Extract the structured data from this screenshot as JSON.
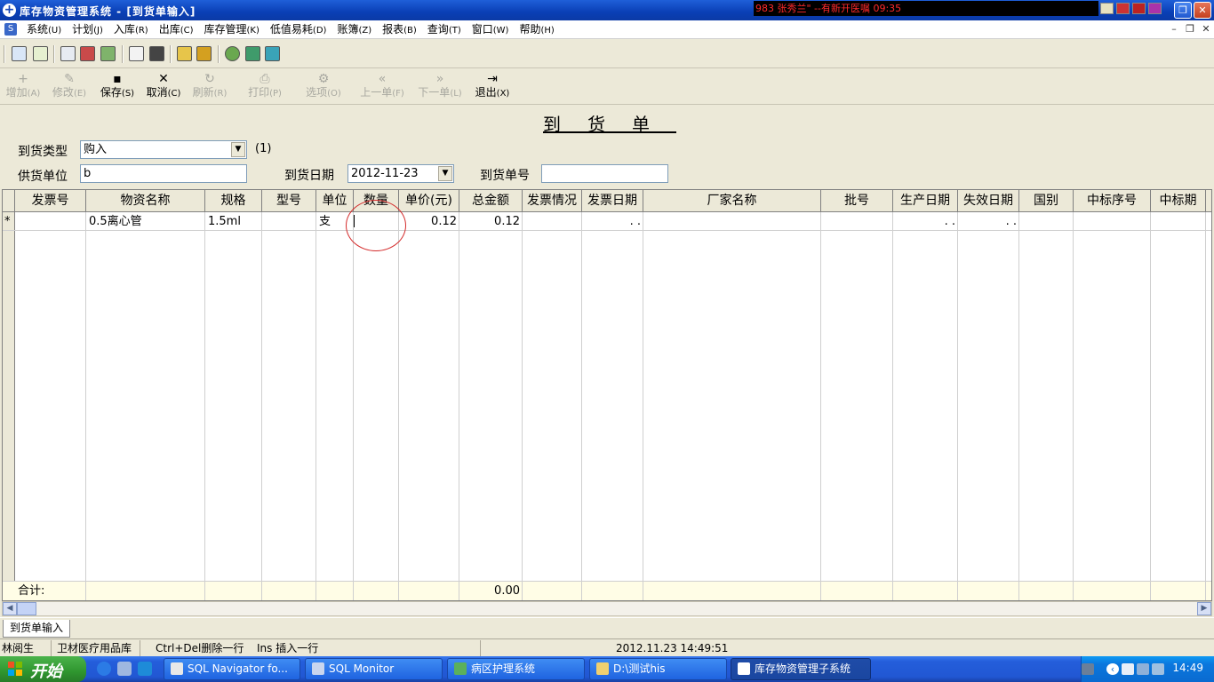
{
  "window": {
    "title": "库存物资管理系统 - [到货单输入]",
    "ticker": "983 张秀兰\" --有新开医嘱 09:35",
    "min_glyph": "_",
    "restore_glyph": "❐",
    "close_glyph": "✕"
  },
  "menubar": {
    "items": [
      {
        "label": "系统",
        "accel": "(U)"
      },
      {
        "label": "计划",
        "accel": "(J)"
      },
      {
        "label": "入库",
        "accel": "(R)"
      },
      {
        "label": "出库",
        "accel": "(C)"
      },
      {
        "label": "库存管理",
        "accel": "(K)"
      },
      {
        "label": "低值易耗",
        "accel": "(D)"
      },
      {
        "label": "账簿",
        "accel": "(Z)"
      },
      {
        "label": "报表",
        "accel": "(B)"
      },
      {
        "label": "查询",
        "accel": "(T)"
      },
      {
        "label": "窗口",
        "accel": "(W)"
      },
      {
        "label": "帮助",
        "accel": "(H)"
      }
    ],
    "mdi_min": "–",
    "mdi_restore": "❐",
    "mdi_close": "✕"
  },
  "toolbar": {
    "buttons": [
      {
        "label": "增加",
        "accel": "(A)",
        "glyph": "+",
        "enabled": false
      },
      {
        "label": "修改",
        "accel": "(E)",
        "glyph": "✎",
        "enabled": false
      },
      {
        "label": "保存",
        "accel": "(S)",
        "glyph": "▪",
        "enabled": true
      },
      {
        "label": "取消",
        "accel": "(C)",
        "glyph": "✕",
        "enabled": true
      },
      {
        "label": "刷新",
        "accel": "(R)",
        "glyph": "↻",
        "enabled": false
      },
      {
        "label": "打印",
        "accel": "(P)",
        "glyph": "⎙",
        "enabled": false
      },
      {
        "label": "选项",
        "accel": "(O)",
        "glyph": "⚙",
        "enabled": false
      },
      {
        "label": "上一单",
        "accel": "(F)",
        "glyph": "«",
        "enabled": false
      },
      {
        "label": "下一单",
        "accel": "(L)",
        "glyph": "»",
        "enabled": false
      },
      {
        "label": "退出",
        "accel": "(X)",
        "glyph": "⇥",
        "enabled": true
      }
    ]
  },
  "form": {
    "title": "到货单",
    "type_label": "到货类型",
    "type_value": "购入",
    "type_hint": "(1)",
    "supplier_label": "供货单位",
    "supplier_value": "b",
    "date_label": "到货日期",
    "date_value": "2012-11-23",
    "number_label": "到货单号",
    "number_value": ""
  },
  "grid": {
    "columns": [
      "发票号",
      "物资名称",
      "规格",
      "型号",
      "单位",
      "数量",
      "单价(元)",
      "总金额",
      "发票情况",
      "发票日期",
      "厂家名称",
      "批号",
      "生产日期",
      "失效日期",
      "国别",
      "中标序号",
      "中标期"
    ],
    "rows": [
      {
        "marker": "*",
        "cells": [
          "",
          "0.5离心管",
          "1.5ml",
          "",
          "支",
          "",
          "0.12",
          "0.12",
          "",
          ". .",
          "",
          "",
          ". .",
          ". .",
          "",
          "",
          ""
        ]
      }
    ],
    "footer_label": "合计:",
    "footer_total": "0.00"
  },
  "tabs": [
    {
      "label": "到货单输入"
    }
  ],
  "statusbar": {
    "user": "林阅生",
    "department": "卫材医疗用品库",
    "hint_delete": "Ctrl+Del删除一行",
    "hint_insert": "Ins 插入一行",
    "datetime": "2012.11.23 14:49:51"
  },
  "taskbar": {
    "start": "开始",
    "tasks": [
      {
        "label": "SQL Navigator fo...",
        "active": false
      },
      {
        "label": "SQL Monitor",
        "active": false
      },
      {
        "label": "病区护理系统",
        "active": false
      },
      {
        "label": "D:\\测试his",
        "active": false
      },
      {
        "label": "库存物资管理子系统",
        "active": true
      }
    ],
    "clock": "14:49",
    "tray_chevron": "‹"
  },
  "colors": {
    "title_bar": "#0a3fb5",
    "ticker_text": "#ff2a2a",
    "annotation_circle": "#d42b2b",
    "footer_bg": "#fffde6",
    "taskbar": "#2157d3",
    "start_button": "#2f962f"
  }
}
